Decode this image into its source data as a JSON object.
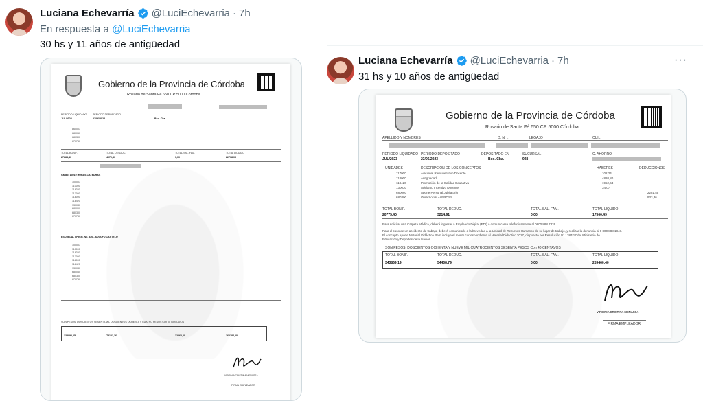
{
  "tweet1": {
    "name": "Luciana Echevarría",
    "handle": "@LuciEchevarria",
    "dot": "·",
    "time": "7h",
    "reply_prefix": "En respuesta a ",
    "reply_handle": "@LuciEchevarria",
    "text": "30 hs y 11 años de antigüedad",
    "doc": {
      "title": "Gobierno de la Provincia de Córdoba",
      "address": "Rosario de Santa Fé 650 CP:5000 Córdoba",
      "periodo_label": "PERIODO LIQUIDADO",
      "periodo_value": "JUL/2023",
      "deposito_label": "PERIODO DEPOSITADO",
      "deposito_value": "22/06/2023",
      "bco": "Bco. Cba.",
      "total_bonif_label": "TOTAL BONIF.",
      "total_desc_label": "TOTAL DESDUC.",
      "total_sal_label": "TOTAL SAL. FAM.",
      "total_liq_label": "TOTAL LIQUIDO",
      "total_bonif": "27888,43",
      "total_desc": "4970,83",
      "total_sal": "0,00",
      "total_liq": "22708,05",
      "cargo1": "Cargo: 13010 HORAS CATEDRAS",
      "cargo2": "ESCUELA - I.P.E.M. No. 326 - ADOLFO CASTELO",
      "son_pesos": "SON PESOS: DOSCIENTOS SESENTA MIL DOSCIENTOS OCHENTA Y CUATRO PESOS Con 00 CENTAVOS",
      "final_bonif": "335890,05",
      "final_desc": "75101,16",
      "final_sal": "12060,00",
      "final_liq": "260284,00",
      "firma": "FIRMA EMPLEADOR",
      "firmante": "VIRGINIA CRISTINA MENASSA"
    }
  },
  "tweet2": {
    "name": "Luciana Echevarría",
    "handle": "@LuciEchevarria",
    "dot": "·",
    "time": "7h",
    "more": "···",
    "text": "31 hs y 10 años de antigüedad",
    "doc": {
      "title": "Gobierno de la Provincia de Córdoba",
      "address": "Rosario de Santa Fé 650 CP:5000 Córdoba",
      "apellido_label": "APELLIDO Y NOMBRES",
      "dni_label": "D. N. I.",
      "legajo_label": "LEGAJO",
      "cuil_label": "CUIL",
      "periodo_label": "PERIODO LIQUIDADO",
      "periodo_value": "JUL/2023",
      "deposito_label": "PERIODO DEPOSITADO",
      "deposito_value": "23/06/2023",
      "depositado_label": "DEPOSITADO EN",
      "depositado_value": "Bco. Cba.",
      "sucursal_label": "SUCURSAL",
      "sucursal_value": "928",
      "ahorro_label": "C. AHORRO",
      "unidades_label": "UNIDADES",
      "desc_label": "DESCRIPCION DE LOS CONCEPTOS",
      "haberes_label": "HABERES",
      "deducciones_label": "DEDUCCIONES",
      "rows": [
        {
          "code": "117000",
          "desc": "Adicional Remunerativo Docente",
          "haber": "102,24",
          "deduc": ""
        },
        {
          "code": "118000",
          "desc": "Antigüedad",
          "haber": "4820,80",
          "deduc": ""
        },
        {
          "code": "118420",
          "desc": "Promoción de la Calidad Educativa",
          "haber": "1952,64",
          "deduc": ""
        },
        {
          "code": "130030",
          "desc": "Adelanto Incentivo Docente",
          "haber": "34,07",
          "deduc": ""
        },
        {
          "code": "680060",
          "desc": "Aporte Personal Jubilatorio",
          "haber": "",
          "deduc": "2281,55"
        },
        {
          "code": "680300",
          "desc": "Obra Social - APROSS",
          "haber": "",
          "deduc": "933,36"
        }
      ],
      "total_bonif_label": "TOTAL BONIF.",
      "total_desc_label": "TOTAL DEDUC.",
      "total_sal_label": "TOTAL SAL. FAM.",
      "total_liq_label": "TOTAL LIQUIDO",
      "total_bonif": "20775,40",
      "total_desc": "3214,91",
      "total_sal": "0,00",
      "total_liq": "17560,49",
      "note1": "Para solicitar una Carpeta Médica, deberá ingresar a Empleado Digital (EDI) o comunicarse telefónicamente al 0800 888 7326.",
      "note2": "Para el caso de un accidente de trabajo, deberá comunicarlo a la brevedad a la Unidad de Recursos Humanos de su lugar de trabajo, y realizar la denuncia al 0 800 888 1848.",
      "note3": "El concepto Aporte Material Didáctico Rem incluye el monto correspondiente al Material Didáctico 2017, dispuesto por Resolución N° 1387/17 del Ministerio de",
      "note4": "Educación y Deportes de la Nación",
      "son_pesos": "SON PESOS: DOSCIENTOS OCHENTA Y NUEVE MIL CUATROCIENTOS SESENTA PESOS Con 40 CENTAVOS",
      "final_bonif": "343869,19",
      "final_desc": "54408,79",
      "final_sal": "0,00",
      "final_liq": "289460,40",
      "firmante": "VIRGINIA CRISTINA MENASSA",
      "firma": "FIRMA EMPLEADOR"
    }
  },
  "colors": {
    "link": "#1d9bf0",
    "muted": "#536471",
    "text": "#0f1419",
    "verified": "#1d9bf0"
  },
  "icons": {
    "verified": "verified-badge-icon",
    "more": "more-icon"
  }
}
